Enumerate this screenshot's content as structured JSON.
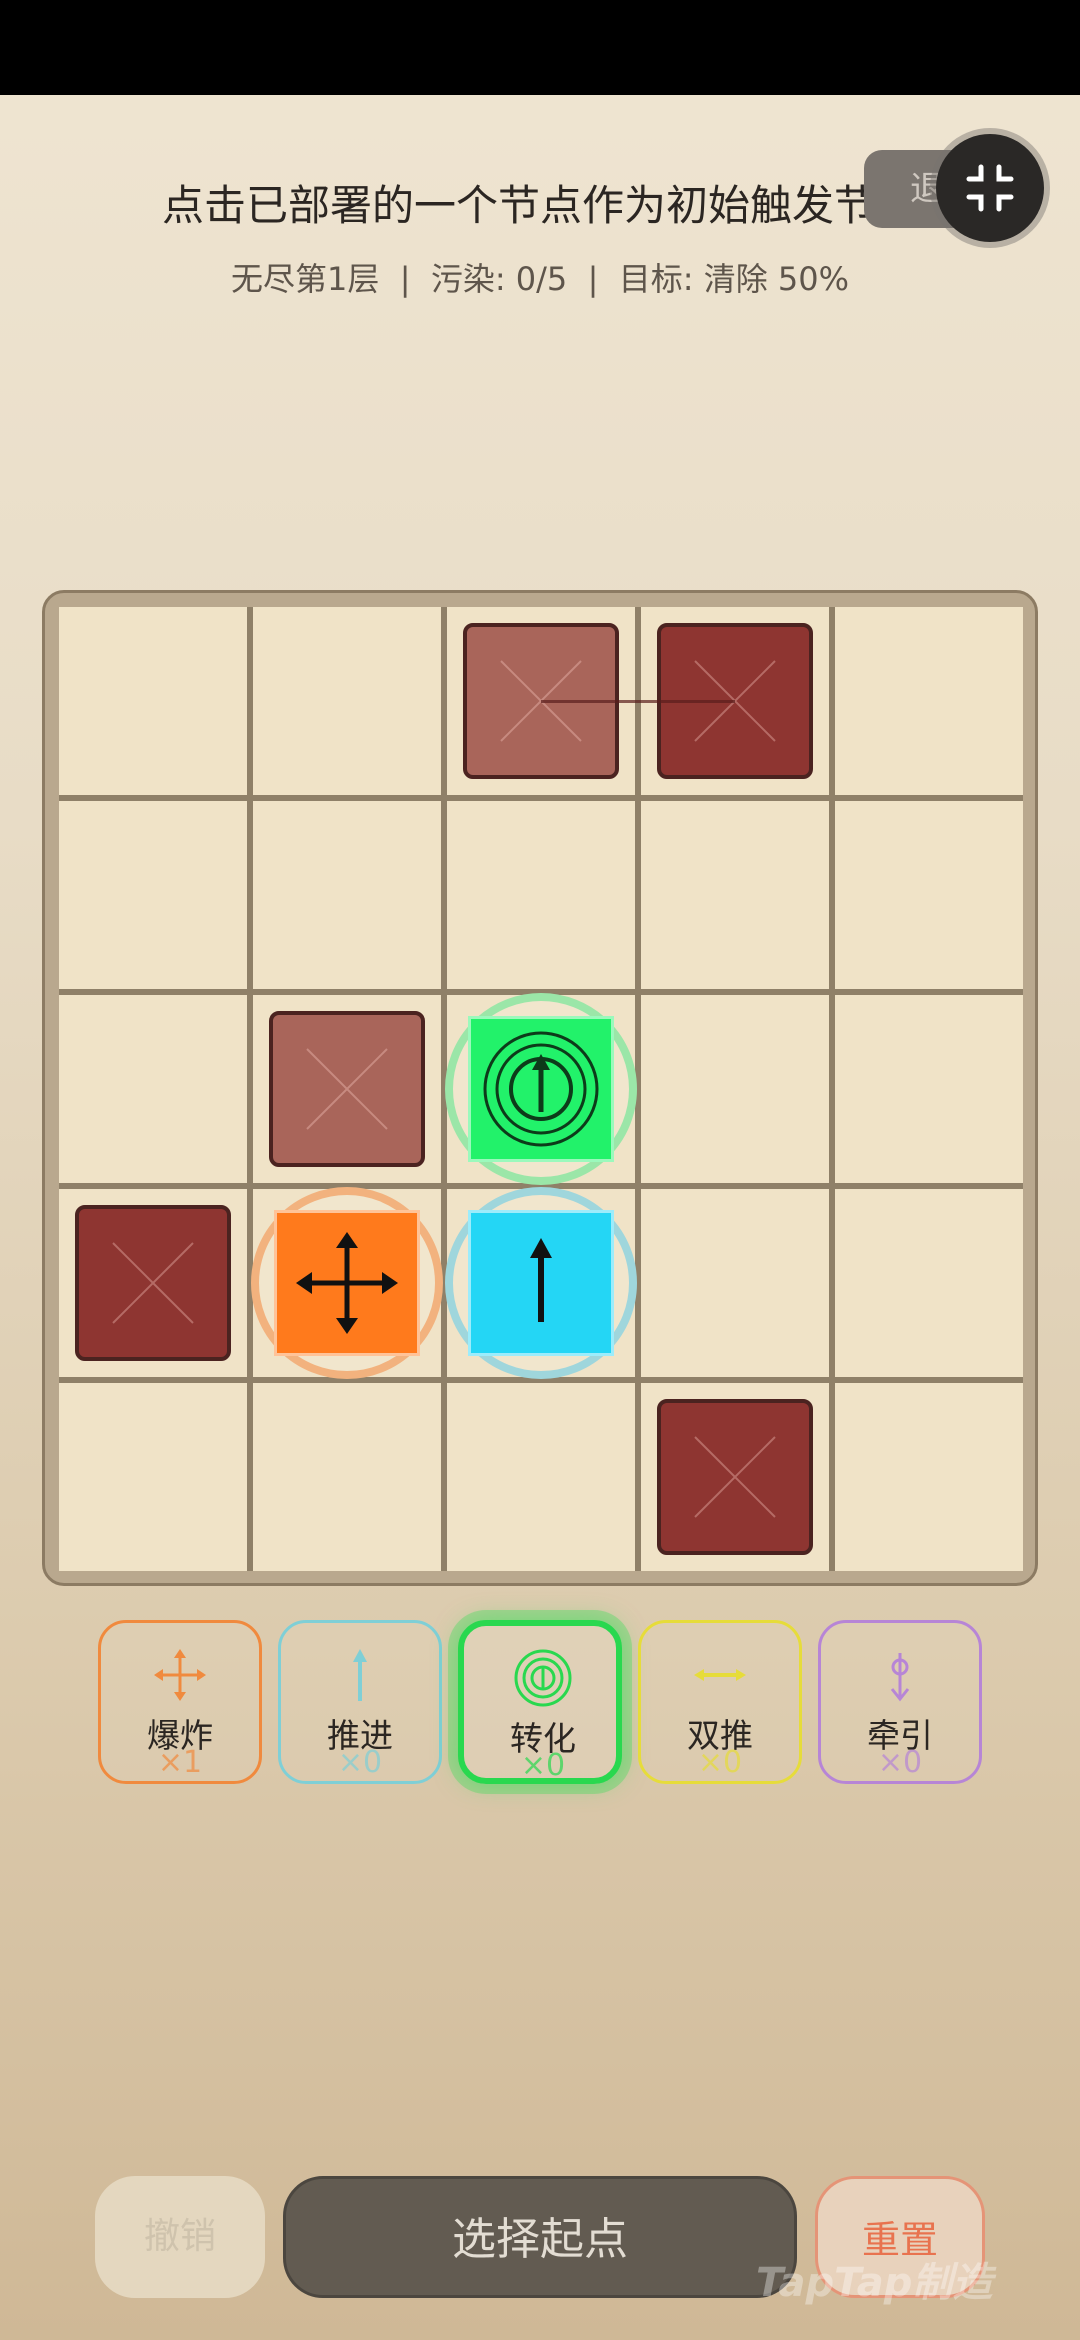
{
  "header": {
    "title": "点击已部署的一个节点作为初始触发节点",
    "subtitle": "无尽第1层  |  污染: 0/5  |  目标: 清除 50%",
    "exit_label": "退出"
  },
  "board": {
    "rows": 5,
    "cols": 5,
    "blocks": [
      {
        "row": 0,
        "col": 2,
        "shade": "light"
      },
      {
        "row": 0,
        "col": 3,
        "shade": "dark"
      },
      {
        "row": 2,
        "col": 1,
        "shade": "light"
      },
      {
        "row": 3,
        "col": 0,
        "shade": "dark"
      },
      {
        "row": 4,
        "col": 3,
        "shade": "dark"
      }
    ],
    "nodes": [
      {
        "row": 2,
        "col": 2,
        "type": "convert",
        "color": "#22f26a",
        "halo": "#9be6a8"
      },
      {
        "row": 3,
        "col": 1,
        "type": "explode",
        "color": "#ff7a1c",
        "halo": "#f2b27e"
      },
      {
        "row": 3,
        "col": 2,
        "type": "push",
        "color": "#24d6f5",
        "halo": "#9fd6dc"
      }
    ]
  },
  "tools": [
    {
      "id": "explode",
      "label": "爆炸",
      "count": "×1",
      "color": "#f08a3e"
    },
    {
      "id": "push",
      "label": "推进",
      "count": "×0",
      "color": "#7fcfd6"
    },
    {
      "id": "convert",
      "label": "转化",
      "count": "×0",
      "color": "#29d84f",
      "selected": true
    },
    {
      "id": "double_push",
      "label": "双推",
      "count": "×0",
      "color": "#e6dc3a"
    },
    {
      "id": "pull",
      "label": "牵引",
      "count": "×0",
      "color": "#b785d6"
    }
  ],
  "bottom": {
    "undo_label": "撤销",
    "start_label": "选择起点",
    "reset_label": "重置"
  },
  "watermark": "TapTap制造"
}
